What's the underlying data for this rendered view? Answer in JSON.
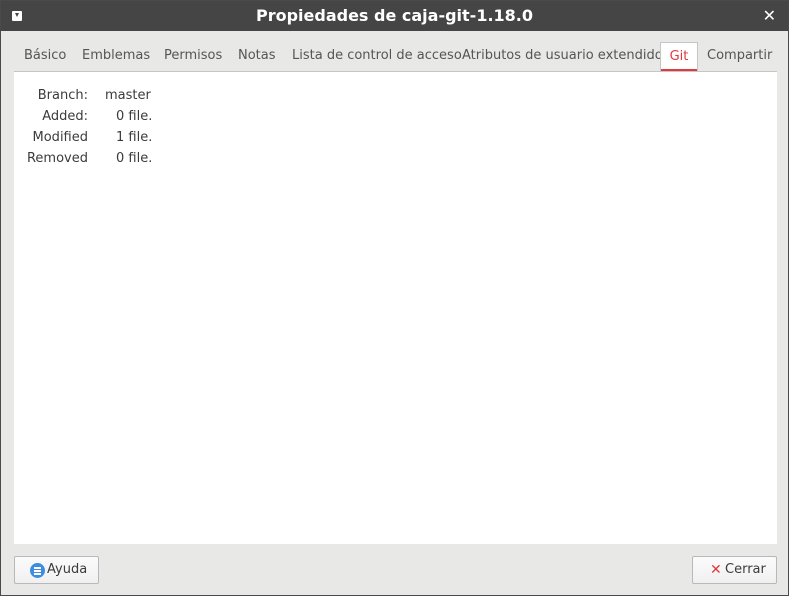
{
  "window": {
    "title": "Propiedades de caja-git-1.18.0"
  },
  "tabs": [
    {
      "label": "Básico"
    },
    {
      "label": "Emblemas"
    },
    {
      "label": "Permisos"
    },
    {
      "label": "Notas"
    },
    {
      "label": "Lista de control de acceso"
    },
    {
      "label": "Atributos de usuario extendidos"
    },
    {
      "label": "Git",
      "active": true
    },
    {
      "label": "Compartir"
    }
  ],
  "git": {
    "rows": [
      {
        "label": "Branch:",
        "value": "master"
      },
      {
        "label": "Added:",
        "value": "0 file."
      },
      {
        "label": "Modified",
        "value": "1 file."
      },
      {
        "label": "Removed",
        "value": "0 file."
      }
    ]
  },
  "buttons": {
    "help": "Ayuda",
    "close": "Cerrar"
  },
  "colors": {
    "titlebar": "#454545",
    "accent": "#e0393e",
    "help_icon": "#3d8ee0"
  }
}
